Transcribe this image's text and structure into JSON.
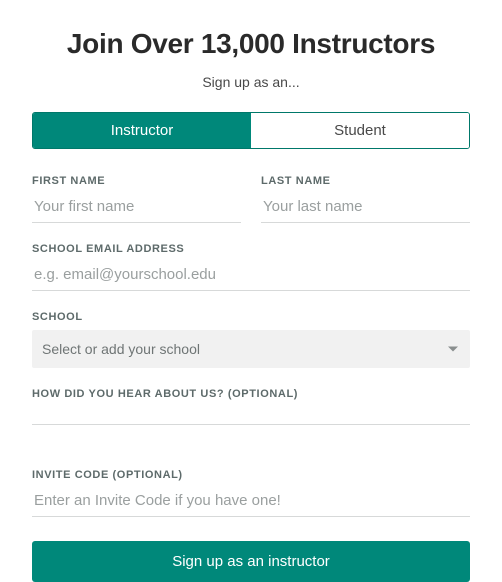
{
  "heading": "Join Over 13,000 Instructors",
  "subheading": "Sign up as an...",
  "tabs": {
    "instructor": "Instructor",
    "student": "Student"
  },
  "fields": {
    "firstName": {
      "label": "FIRST NAME",
      "placeholder": "Your first name"
    },
    "lastName": {
      "label": "LAST NAME",
      "placeholder": "Your last name"
    },
    "email": {
      "label": "SCHOOL EMAIL ADDRESS",
      "placeholder": "e.g. email@yourschool.edu"
    },
    "school": {
      "label": "SCHOOL",
      "placeholder": "Select or add your school"
    },
    "howHeard": {
      "label": "HOW DID YOU HEAR ABOUT US? (OPTIONAL)"
    },
    "inviteCode": {
      "label": "INVITE CODE (OPTIONAL)",
      "placeholder": "Enter an Invite Code if you have one!"
    }
  },
  "submit": "Sign up as an instructor"
}
